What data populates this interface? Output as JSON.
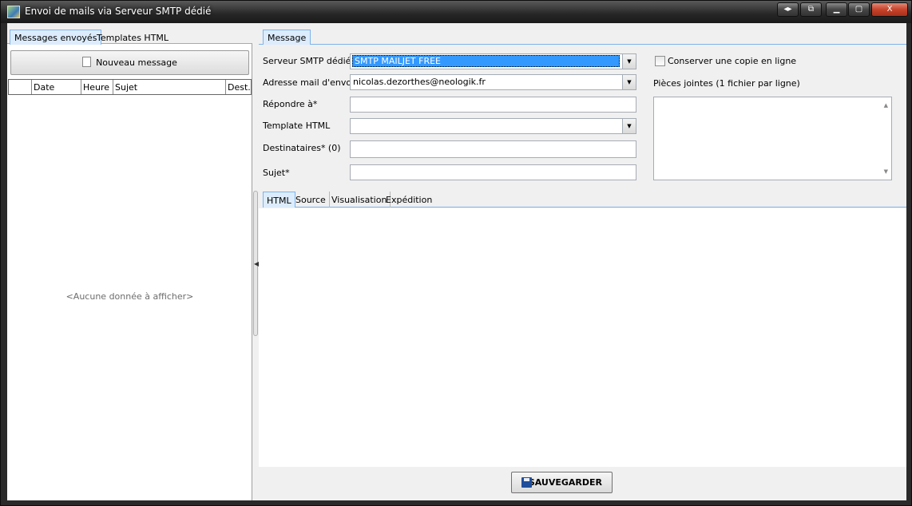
{
  "window": {
    "title": "Envoi de mails via Serveur SMTP dédié",
    "buttons": {
      "nav": "◂▸",
      "detach": "⧉",
      "minimize": "▁",
      "maximize": "▢",
      "close": "X"
    }
  },
  "left_panel": {
    "tabs": [
      "Messages envoyés",
      "Templates HTML"
    ],
    "new_message_label": "Nouveau message",
    "columns": [
      "Date",
      "Heure",
      "Sujet",
      "Dest."
    ],
    "empty_text": "<Aucune donnée à afficher>"
  },
  "right_panel": {
    "tab": "Message",
    "form": {
      "smtp_label": "Serveur SMTP dédié*",
      "smtp_value": "SMTP MAILJET FREE",
      "from_label": "Adresse mail d'envoi*",
      "from_value": "nicolas.dezorthes@neologik.fr",
      "reply_label": "Répondre à*",
      "reply_value": "",
      "template_label": "Template HTML",
      "template_value": "",
      "recipients_label": "Destinataires* (0)",
      "recipients_value": "",
      "subject_label": "Sujet*",
      "subject_value": ""
    },
    "keep_copy_label": "Conserver une copie en ligne",
    "attachments_label": "Pièces jointes (1 fichier par ligne)",
    "editor_tabs": [
      "HTML",
      "Source",
      "Visualisation",
      "Expédition"
    ],
    "save_label": "SAUVEGARDER"
  },
  "colors": {
    "tab_active": "#dcecfc",
    "tab_border": "#7eb4ea",
    "selection": "#3399ff"
  }
}
